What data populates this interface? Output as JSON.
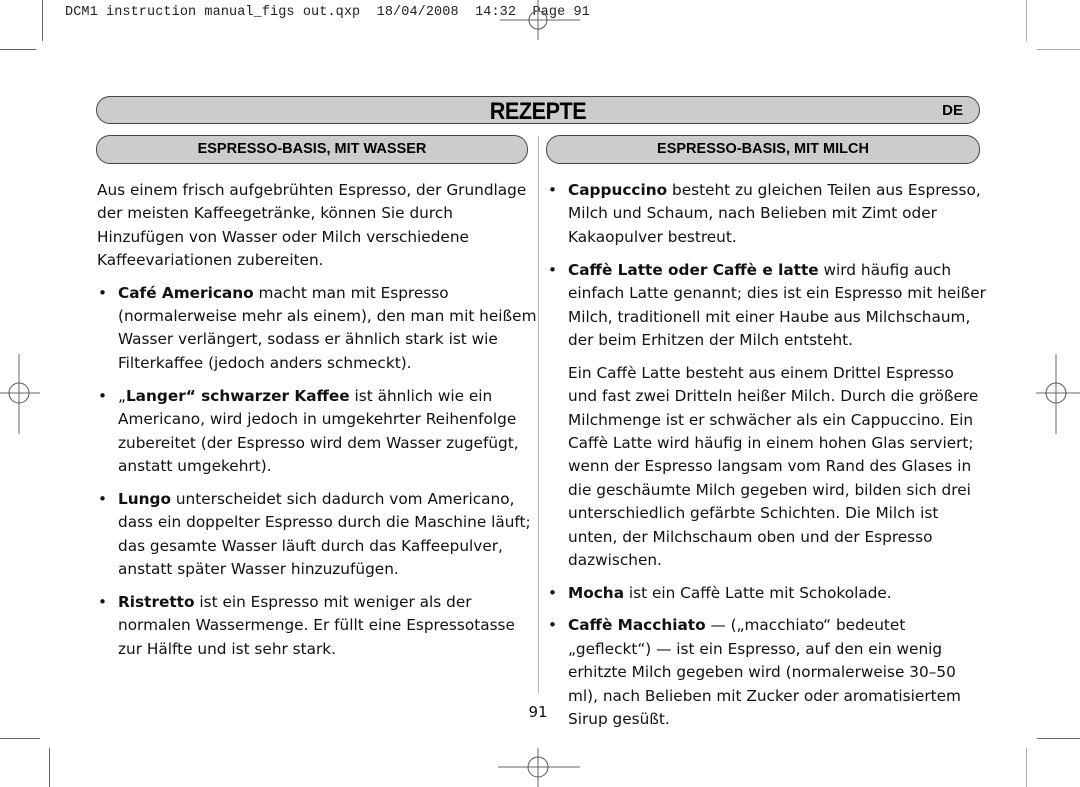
{
  "slug_line": "DCM1 instruction manual_figs out.qxp  18/04/2008  14:32  Page 91",
  "header": {
    "title": "REZEPTE",
    "language": "DE"
  },
  "sections": {
    "left_title": "ESPRESSO-BASIS, MIT WASSER",
    "right_title": "ESPRESSO-BASIS, MIT MILCH"
  },
  "left_column": {
    "intro": "Aus einem frisch aufgebrühten Espresso, der Grundlage der meisten Kaffeegetränke, können Sie durch Hinzufügen von Wasser oder Milch verschiedene Kaffeevariationen zubereiten.",
    "items": [
      {
        "prefix": "",
        "term": "Café Americano",
        "text": " macht man mit Espresso (normalerweise mehr als einem), den man mit heißem Wasser verlängert, sodass er ähnlich stark ist wie Filterkaffee (jedoch anders schmeckt)."
      },
      {
        "prefix": "„",
        "term": "Langer“ schwarzer Kaffee",
        "text": " ist ähnlich wie ein Americano, wird jedoch in umgekehrter Reihenfolge zubereitet (der Espresso wird dem Wasser zugefügt, anstatt umgekehrt)."
      },
      {
        "prefix": "",
        "term": "Lungo",
        "text": " unterscheidet sich dadurch vom Americano, dass ein doppelter Espresso durch die Maschine läuft; das gesamte Wasser läuft durch das Kaffeepulver, anstatt später Wasser hinzuzufügen."
      },
      {
        "prefix": "",
        "term": "Ristretto",
        "text": " ist ein Espresso mit weniger als der normalen Wassermenge. Er füllt eine Espressotasse zur Hälfte und ist sehr stark."
      }
    ]
  },
  "right_column": {
    "items": [
      {
        "term": "Cappuccino",
        "text": " besteht zu gleichen Teilen aus Espresso, Milch und Schaum, nach Belieben mit Zimt oder Kakaopulver bestreut."
      },
      {
        "term": "Caffè Latte oder Caffè e latte",
        "text": " wird häufig auch einfach Latte genannt; dies ist ein Espresso mit heißer Milch, traditionell mit einer Haube aus Milchschaum, der beim Erhitzen der Milch entsteht."
      }
    ],
    "latte_paragraph": "Ein Caffè Latte besteht aus einem Drittel Espresso und fast zwei Dritteln heißer Milch. Durch die größere Milchmenge ist er schwächer als ein Cappuccino. Ein Caffè Latte wird häufig in einem hohen Glas serviert; wenn der Espresso langsam vom Rand des Glases in die geschäumte Milch gegeben wird, bilden sich drei unterschiedlich gefärbte Schichten. Die Milch ist unten, der Milchschaum oben und der Espresso dazwischen.",
    "items2": [
      {
        "term": "Mocha",
        "text": " ist ein Caffè Latte mit Schokolade."
      },
      {
        "term": "Caffè Macchiato",
        "text": " — („macchiato“ bedeutet „gefleckt“) — ist ein Espresso, auf den ein wenig erhitzte Milch gegeben wird (normalerweise 30–50 ml), nach Belieben mit Zucker oder aromatisiertem Sirup gesüßt."
      }
    ]
  },
  "bullet_glyph": "•",
  "page_number": "91"
}
